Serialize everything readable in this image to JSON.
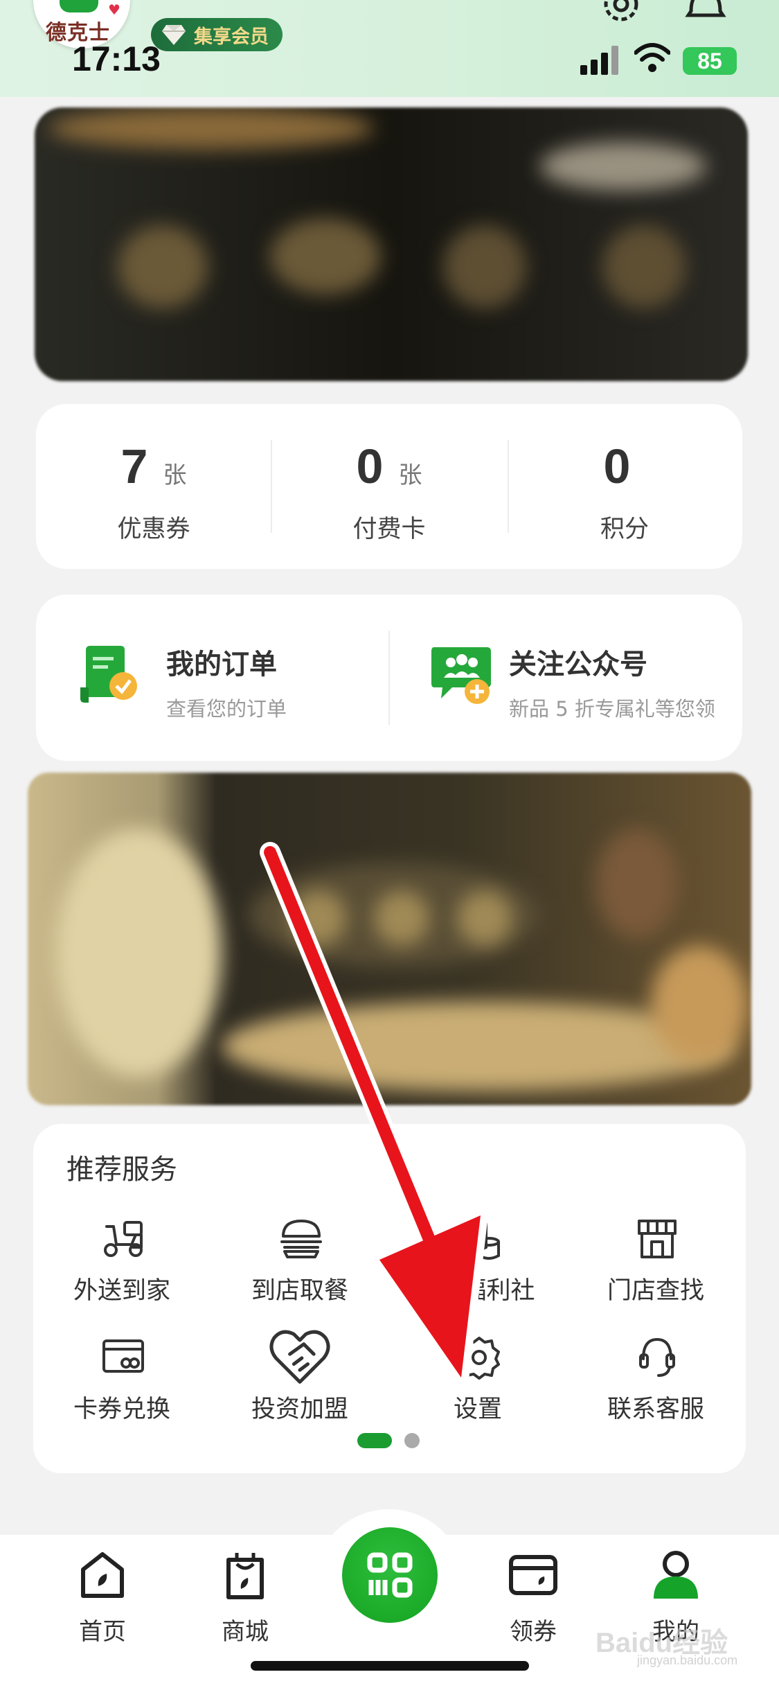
{
  "brand": {
    "logo_text": "德克士",
    "member_badge": "集享会员"
  },
  "status_bar": {
    "time": "17:13",
    "battery": "85"
  },
  "header_icons": {
    "settings": "gear-icon",
    "notifications": "bell-icon"
  },
  "stats": [
    {
      "value": "7",
      "unit": "张",
      "label": "优惠券"
    },
    {
      "value": "0",
      "unit": "张",
      "label": "付费卡"
    },
    {
      "value": "0",
      "unit": "",
      "label": "积分"
    }
  ],
  "quick_links": {
    "orders": {
      "title": "我的订单",
      "subtitle": "查看您的订单",
      "icon": "order-doc-icon"
    },
    "follow": {
      "title": "关注公众号",
      "subtitle": "新品 5 折专属礼等您领",
      "icon": "group-chat-icon"
    }
  },
  "services": {
    "title": "推荐服务",
    "items": [
      {
        "label": "外送到家",
        "icon": "scooter-icon"
      },
      {
        "label": "到店取餐",
        "icon": "burger-icon"
      },
      {
        "label": "福利社",
        "icon": "coins-icon"
      },
      {
        "label": "门店查找",
        "icon": "store-icon"
      },
      {
        "label": "卡券兑换",
        "icon": "card-exchange-icon"
      },
      {
        "label": "投资加盟",
        "icon": "handshake-icon"
      },
      {
        "label": "设置",
        "icon": "gear-icon"
      },
      {
        "label": "联系客服",
        "icon": "headset-icon"
      }
    ],
    "pager": {
      "current": 1,
      "total": 2
    }
  },
  "tabbar": {
    "items": [
      {
        "label": "首页",
        "icon": "home-icon"
      },
      {
        "label": "商城",
        "icon": "shopping-bag-icon"
      },
      {
        "label": "",
        "icon": "scan-code-icon"
      },
      {
        "label": "领券",
        "icon": "wallet-icon"
      },
      {
        "label": "我的",
        "icon": "user-icon",
        "active": true
      }
    ]
  },
  "watermark": {
    "text": "Baidu经验",
    "sub": "jingyan.baidu.com"
  },
  "colors": {
    "brand_green": "#1a9c31",
    "annotation_red": "#e8141b"
  }
}
